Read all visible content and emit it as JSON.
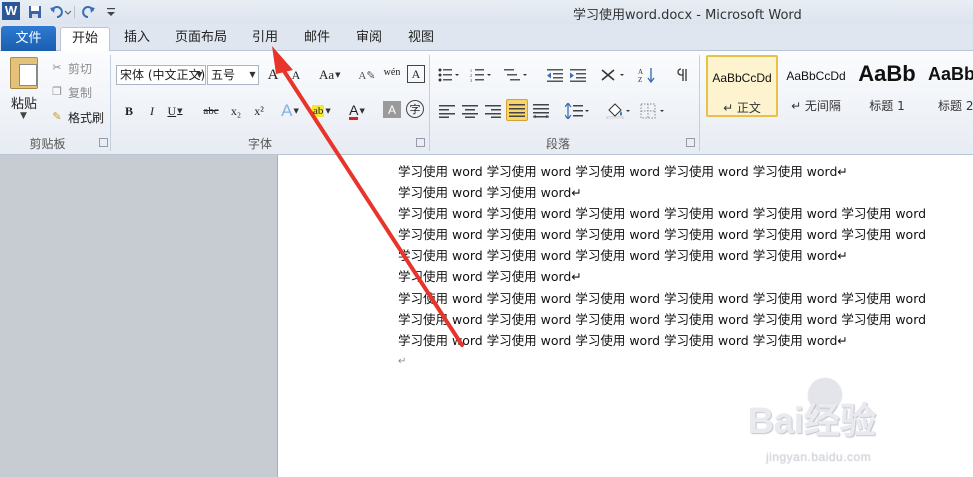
{
  "window": {
    "title": "学习使用word.docx - Microsoft Word",
    "app_icon_letter": "W"
  },
  "quick_access": {
    "save_icon": "save-icon",
    "undo_icon": "undo-icon",
    "redo_icon": "redo-icon",
    "customize_icon": "customize-icon"
  },
  "tabs": {
    "file": "文件",
    "items": [
      "开始",
      "插入",
      "页面布局",
      "引用",
      "邮件",
      "审阅",
      "视图"
    ],
    "active": "开始"
  },
  "clipboard": {
    "paste": "粘贴",
    "cut": "剪切",
    "copy": "复制",
    "format_painter": "格式刷",
    "group_label": "剪贴板"
  },
  "font": {
    "font_name": "宋体 (中文正文)",
    "font_size": "五号",
    "grow_label": "A",
    "shrink_label": "A",
    "change_case_label": "Aa",
    "clear_format_label": "A",
    "phonetic_label": "wén",
    "border_char_label": "A",
    "bold": "B",
    "italic": "I",
    "underline": "U",
    "strike": "abc",
    "subscript": "x₂",
    "superscript": "x²",
    "text_effect": "A",
    "highlight": "ab",
    "font_color": "A",
    "char_shading": "A",
    "enclose_char": "字",
    "group_label": "字体",
    "font_color_hex": "#e02020",
    "highlight_hex": "#f5e632"
  },
  "paragraph": {
    "group_label": "段落"
  },
  "styles": {
    "cards": [
      {
        "sample": "AaBbCcDd",
        "name": "↵ 正文"
      },
      {
        "sample": "AaBbCcDd",
        "name": "↵ 无间隔"
      },
      {
        "sample": "AaBb",
        "name": "标题 1"
      },
      {
        "sample": "AaBb",
        "name": "标题 2"
      }
    ],
    "selected": "正文"
  },
  "document": {
    "lines": [
      "学习使用 word 学习使用 word 学习使用 word 学习使用 word 学习使用 word↵",
      "学习使用 word 学习使用 word↵",
      "学习使用 word 学习使用 word 学习使用 word 学习使用 word 学习使用 word 学习使用 word",
      "学习使用 word 学习使用 word 学习使用 word 学习使用 word 学习使用 word 学习使用 word",
      "学习使用 word 学习使用 word 学习使用 word 学习使用 word 学习使用 word↵",
      "学习使用 word 学习使用 word↵",
      "学习使用 word 学习使用 word 学习使用 word 学习使用 word 学习使用 word 学习使用 word",
      "学习使用 word 学习使用 word 学习使用 word 学习使用 word 学习使用 word 学习使用 word",
      "学习使用 word 学习使用 word 学习使用 word 学习使用 word 学习使用 word↵",
      "↵"
    ]
  },
  "annotation": {
    "arrow_color": "#e8342a",
    "points_to": "引用"
  },
  "watermark": {
    "brand": "Bai经验",
    "url": "jingyan.baidu.com"
  }
}
